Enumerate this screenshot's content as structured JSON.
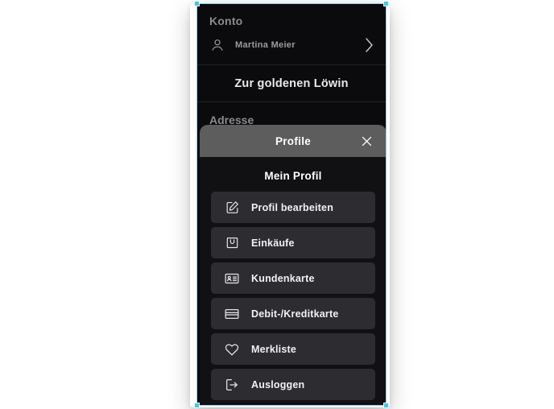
{
  "panel": {
    "account": {
      "section_label": "Konto",
      "user_name": "Martina Meier",
      "user_icon": "person-icon",
      "chevron_icon": "chevron-right-icon",
      "store_link_label": "Zur goldenen Löwin",
      "address_label": "Adresse"
    }
  },
  "modal": {
    "header_title": "Profile",
    "close_icon": "close-icon",
    "body_title": "Mein Profil",
    "items": [
      {
        "label": "Profil bearbeiten",
        "icon": "edit-square-pencil-icon"
      },
      {
        "label": "Einkäufe",
        "icon": "shopping-bag-icon"
      },
      {
        "label": "Kundenkarte",
        "icon": "id-card-icon"
      },
      {
        "label": "Debit-/Kreditkarte",
        "icon": "credit-card-icon"
      },
      {
        "label": "Merkliste",
        "icon": "heart-icon"
      },
      {
        "label": "Ausloggen",
        "icon": "logout-icon"
      }
    ]
  },
  "colors": {
    "panel_background": "#0b0b0d",
    "modal_background": "#111114",
    "modal_header": "#5d5d5d",
    "menu_item": "#2c2c31",
    "text_primary": "#f2f2f5",
    "text_muted": "#8b8b91",
    "selection_accent": "#4dc3e0"
  }
}
